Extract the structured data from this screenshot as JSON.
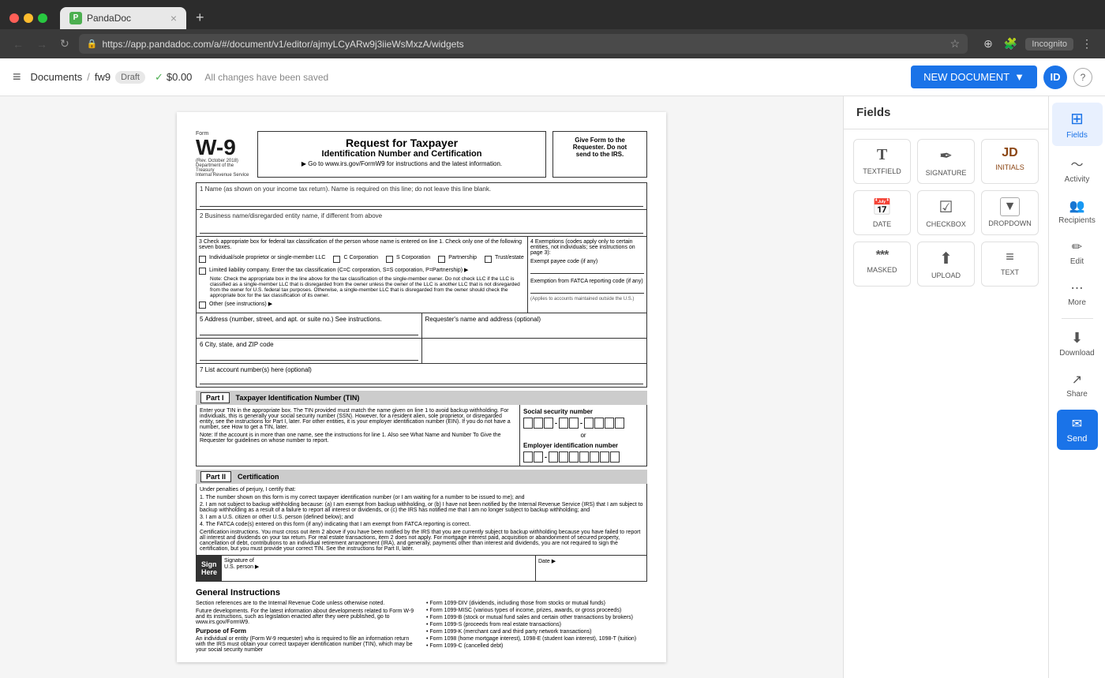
{
  "browser": {
    "tab_favicon": "P",
    "tab_title": "PandaDoc",
    "url": "https://app.pandadoc.com/a/#/document/v1/editor/ajmyLCyARw9j3iieWsMxzA/widgets",
    "incognito_label": "Incognito"
  },
  "toolbar": {
    "menu_icon": "≡",
    "breadcrumb_docs": "Documents",
    "breadcrumb_sep": "/",
    "doc_name": "fw9",
    "draft_label": "Draft",
    "price": "$0.00",
    "saved_text": "All changes have been saved",
    "new_doc_label": "NEW DOCUMENT",
    "user_initial": "ID",
    "help_label": "?"
  },
  "fields_panel": {
    "title": "Fields",
    "items": [
      {
        "icon": "T",
        "label": "TEXTFIELD"
      },
      {
        "icon": "✒",
        "label": "SIGNATURE"
      },
      {
        "icon": "JD",
        "label": "INITIALS"
      },
      {
        "icon": "📅",
        "label": "DATE"
      },
      {
        "icon": "☑",
        "label": "CHECKBOX"
      },
      {
        "icon": "▼",
        "label": "DROPDOWN"
      },
      {
        "icon": "***",
        "label": "MASKED"
      },
      {
        "icon": "⬆",
        "label": "UPLOAD"
      },
      {
        "icon": "≡",
        "label": "TEXT"
      }
    ]
  },
  "right_panel": {
    "items": [
      {
        "icon": "⊞",
        "label": "Fields"
      },
      {
        "icon": "〜",
        "label": "Activity"
      },
      {
        "icon": "👥",
        "label": "Recipients"
      },
      {
        "icon": "✏",
        "label": "Edit"
      },
      {
        "icon": "⋯",
        "label": "More"
      },
      {
        "icon": "⬇",
        "label": "Download"
      },
      {
        "icon": "↗",
        "label": "Share"
      },
      {
        "icon": "✉",
        "label": "Send"
      }
    ]
  },
  "form": {
    "form_label": "Form",
    "form_number": "W-9",
    "form_rev": "(Rev. October 2018)",
    "form_dept": "Department of the Treasury",
    "form_irs": "Internal Revenue Service",
    "title_line1": "Request for Taxpayer",
    "title_line2": "Identification Number and Certification",
    "url_line": "▶ Go to www.irs.gov/FormW9 for instructions and the latest information.",
    "give_form_text": "Give Form to the\nRequester. Do not\nsend to the IRS.",
    "field1_label": "1 Name (as shown on your income tax return). Name is required on this line; do not leave this line blank.",
    "field2_label": "2 Business name/disregarded entity name, if different from above",
    "field3_label": "3 Check appropriate box for federal tax classification of the person whose name is entered on line 1. Check only one of the\nfollowing seven boxes.",
    "field4_label": "4 Exemptions (codes apply only to\ncertain entities, not individuals; see\ninstructions on page 3):",
    "exempt_payee": "Exempt payee code (if any)",
    "fatca_exempt": "Exemption from FATCA reporting\ncode (if any)",
    "fatca_note": "(Applies to accounts maintained outside the U.S.)",
    "cb1_label": "Individual/sole proprietor or\nsingle-member LLC",
    "cb2_label": "C Corporation",
    "cb3_label": "S Corporation",
    "cb4_label": "Partnership",
    "cb5_label": "Trust/estate",
    "llc_label": "Limited liability company. Enter the tax classification (C=C corporation, S=S corporation, P=Partnership) ▶",
    "llc_note": "Note: Check the appropriate box in the line above for the tax classification of the single-member owner. Do not check LLC if the LLC is classified as a single-member LLC that is disregarded from the owner unless the owner of the LLC is another LLC that is not disregarded from the owner for U.S. federal tax purposes. Otherwise, a single-member LLC that is disregarded from the owner should check the appropriate box for the tax classification of its owner.",
    "other_label": "Other (see instructions) ▶",
    "field5_label": "5 Address (number, street, and apt. or suite no.) See instructions.",
    "requesters_label": "Requester's name and address (optional)",
    "field6_label": "6 City, state, and ZIP code",
    "field7_label": "7 List account number(s) here (optional)",
    "part1_roman": "Part I",
    "part1_title": "Taxpayer Identification Number (TIN)",
    "part1_desc": "Enter your TIN in the appropriate box. The TIN provided must match the name given on line 1 to avoid backup withholding. For individuals, this is generally your social security number (SSN). However, for a resident alien, sole proprietor, or disregarded entity, see the instructions for Part I, later. For other entities, it is your employer identification number (EIN). If you do not have a number, see How to get a TIN, later.",
    "part1_note": "Note: If the account is in more than one name, see the instructions for line 1. Also see What Name and Number To Give the Requester for guidelines on whose number to report.",
    "ssn_label": "Social security number",
    "or_text": "or",
    "ein_label": "Employer identification number",
    "part2_roman": "Part II",
    "part2_title": "Certification",
    "cert_intro": "Under penalties of perjury, I certify that:",
    "cert_1": "1. The number shown on this form is my correct taxpayer identification number (or I am waiting for a number to be issued to me); and",
    "cert_2": "2. I am not subject to backup withholding because: (a) I am exempt from backup withholding, or (b) I have not been notified by the Internal Revenue Service (IRS) that I am subject to backup withholding as a result of a failure to report all interest or dividends, or (c) the IRS has notified me that I am no longer subject to backup withholding; and",
    "cert_3": "3. I am a U.S. citizen or other U.S. person (defined below); and",
    "cert_4": "4. The FATCA code(s) entered on this form (if any) indicating that I am exempt from FATCA reporting is correct.",
    "cert_instructions": "Certification instructions. You must cross out item 2 above if you have been notified by the IRS that you are currently subject to backup withholding because you have failed to report all interest and dividends on your tax return. For real estate transactions, item 2 does not apply. For mortgage interest paid, acquisition or abandonment of secured property, cancellation of debt, contributions to an individual retirement arrangement (IRA), and generally, payments other than interest and dividends, you are not required to sign the certification, but you must provide your correct TIN. See the instructions for Part II, later.",
    "sign_here": "Sign\nHere",
    "sign_sig_label": "Signature of\nU.S. person ▶",
    "sign_date_label": "Date ▶",
    "gi_title": "General Instructions",
    "gi_sec_ref": "Section references are to the Internal Revenue Code unless otherwise noted.",
    "gi_future": "Future developments. For the latest information about developments related to Form W-9 and its instructions, such as legislation enacted after they were published, go to www.irs.gov/FormW9.",
    "purpose_title": "Purpose of Form",
    "purpose_text": "An individual or entity (Form W-9 requester) who is required to file an information return with the IRS must obtain your correct taxpayer identification number (TIN), which may be your social security number",
    "gi_right_items": [
      "• Form 1099-DIV (dividends, including those from stocks or mutual funds)",
      "• Form 1099-MISC (various types of income, prizes, awards, or gross proceeds)",
      "• Form 1099-B (stock or mutual fund sales and certain other transactions by brokers)",
      "• Form 1099-S (proceeds from real estate transactions)",
      "• Form 1099-K (merchant card and third party network transactions)",
      "• Form 1098 (home mortgage interest), 1098-E (student loan interest), 1098-T (tuition)",
      "• Form 1099-C (cancelled debt)"
    ]
  }
}
